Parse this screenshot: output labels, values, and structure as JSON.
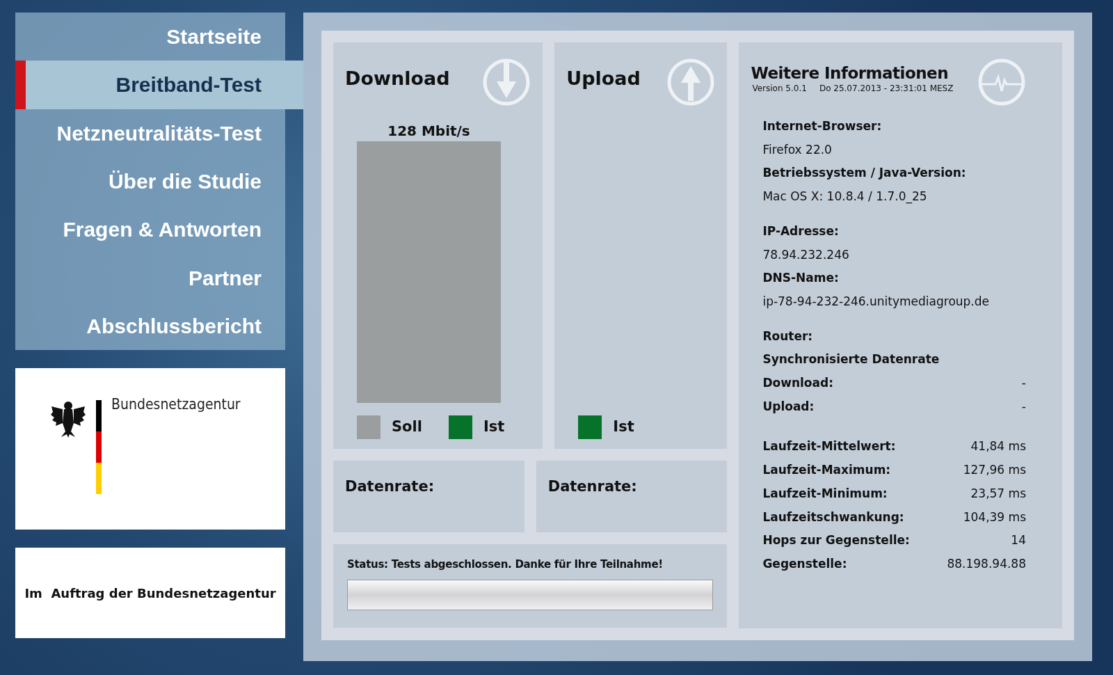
{
  "nav": [
    {
      "label": "Startseite",
      "selected": false
    },
    {
      "label": "Breitband-Test",
      "selected": true
    },
    {
      "label": "Netzneutralitäts-Test",
      "selected": false
    },
    {
      "label": "Über die Studie",
      "selected": false
    },
    {
      "label": "Fragen & Antworten",
      "selected": false
    },
    {
      "label": "Partner",
      "selected": false
    },
    {
      "label": "Abschlussbericht",
      "selected": false
    }
  ],
  "logo": {
    "name": "Bundesnetzagentur"
  },
  "commission": "Im  Auftrag der Bundesnetzagentur",
  "download": {
    "title": "Download",
    "bar_label": "128 Mbit/s",
    "legend": [
      {
        "label": "Soll",
        "color": "#9b9e9f"
      },
      {
        "label": "Ist",
        "color": "#06722a"
      }
    ]
  },
  "upload": {
    "title": "Upload",
    "legend": [
      {
        "label": "Ist",
        "color": "#06722a"
      }
    ]
  },
  "rates": [
    {
      "label": "Datenrate:"
    },
    {
      "label": "Datenrate:"
    }
  ],
  "status": {
    "text": "Status: Tests abgeschlossen. Danke für Ihre Teilnahme!",
    "level": 1
  },
  "info": {
    "title": "Weitere Informationen",
    "version": "Version 5.0.1",
    "date": "Do 25.07.2013 - 23:31:01 MESZ",
    "groups": [
      {
        "rows": [
          {
            "kind": "heading",
            "label": "Internet-Browser:"
          },
          {
            "kind": "text",
            "label": "Firefox 22.0"
          },
          {
            "kind": "heading",
            "label": "Betriebssystem / Java-Version:"
          },
          {
            "kind": "text",
            "label": "Mac OS X: 10.8.4 / 1.7.0_25"
          }
        ]
      },
      {
        "rows": [
          {
            "kind": "heading",
            "label": "IP-Adresse:"
          },
          {
            "kind": "text",
            "label": "78.94.232.246"
          },
          {
            "kind": "heading",
            "label": "DNS-Name:"
          },
          {
            "kind": "text",
            "label": "ip-78-94-232-246.unitymediagroup.de"
          }
        ]
      },
      {
        "rows": [
          {
            "kind": "heading",
            "label": "Router:"
          },
          {
            "kind": "heading",
            "label": "Synchronisierte Datenrate"
          },
          {
            "kind": "pair",
            "label": "Download:",
            "value": "-"
          },
          {
            "kind": "pair",
            "label": "Upload:",
            "value": "-"
          }
        ]
      },
      {
        "rows": [
          {
            "kind": "pair",
            "label": "Laufzeit-Mittelwert:",
            "value": "41,84 ms"
          },
          {
            "kind": "pair",
            "label": "Laufzeit-Maximum:",
            "value": "127,96 ms"
          },
          {
            "kind": "pair",
            "label": "Laufzeit-Minimum:",
            "value": "23,57 ms"
          },
          {
            "kind": "pair",
            "label": "Laufzeitschwankung:",
            "value": "104,39 ms"
          },
          {
            "kind": "pair",
            "label": "Hops zur Gegenstelle:",
            "value": "14"
          },
          {
            "kind": "pair",
            "label": "Gegenstelle:",
            "value": "88.198.94.88"
          }
        ]
      }
    ]
  }
}
